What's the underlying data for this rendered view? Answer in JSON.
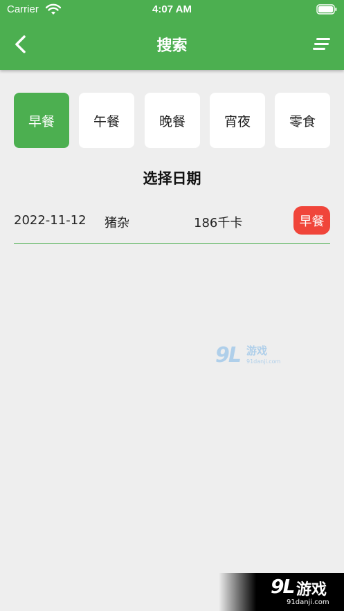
{
  "status_bar": {
    "carrier": "Carrier",
    "time": "4:07 AM"
  },
  "nav": {
    "title": "搜索"
  },
  "meal_tabs": [
    {
      "label": "早餐",
      "selected": true
    },
    {
      "label": "午餐",
      "selected": false
    },
    {
      "label": "晚餐",
      "selected": false
    },
    {
      "label": "宵夜",
      "selected": false
    },
    {
      "label": "零食",
      "selected": false
    }
  ],
  "date_heading": "选择日期",
  "records": [
    {
      "date": "2022-11-12",
      "food": "猪杂",
      "calories": "186千卡",
      "meal": "早餐"
    }
  ],
  "watermark": {
    "number": "9L",
    "name": "游戏",
    "url": "91danji.com"
  },
  "colors": {
    "accent": "#4caf50",
    "badge": "#f0453a",
    "background": "#eeeeee"
  },
  "icons": [
    "wifi-icon",
    "battery-icon",
    "back-arrow-icon",
    "menu-icon"
  ]
}
